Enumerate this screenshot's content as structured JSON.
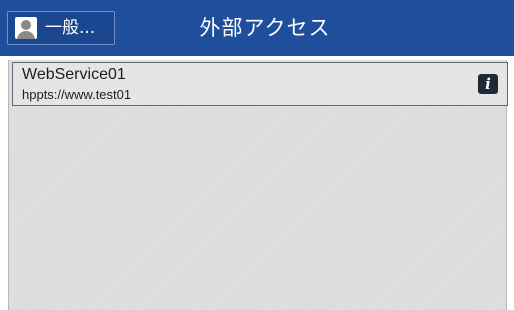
{
  "header": {
    "user_button_label": "一般...",
    "title": "外部アクセス",
    "user_icon": "user-icon"
  },
  "services": [
    {
      "name": "WebService01",
      "url": "hppts://www.test01",
      "info_icon": "info-icon",
      "info_glyph": "i"
    }
  ],
  "colors": {
    "header_bg": "#1f4f9c",
    "content_bg": "#dadada",
    "item_border": "#5e6b7a",
    "info_bg": "#1f2937"
  }
}
